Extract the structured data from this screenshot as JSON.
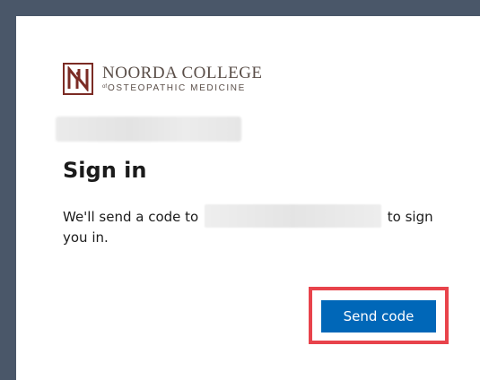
{
  "org": {
    "logo_name": "NOORDA COLLEGE",
    "logo_of": "of",
    "logo_subtitle": "OSTEOPATHIC MEDICINE"
  },
  "signin": {
    "title": "Sign in",
    "message_before": "We'll send a code to",
    "message_after": " to sign you in."
  },
  "actions": {
    "send_code_label": "Send code"
  },
  "colors": {
    "primary_button": "#0067b8",
    "highlight": "#e8434b",
    "logo_brand": "#7b2b24"
  }
}
